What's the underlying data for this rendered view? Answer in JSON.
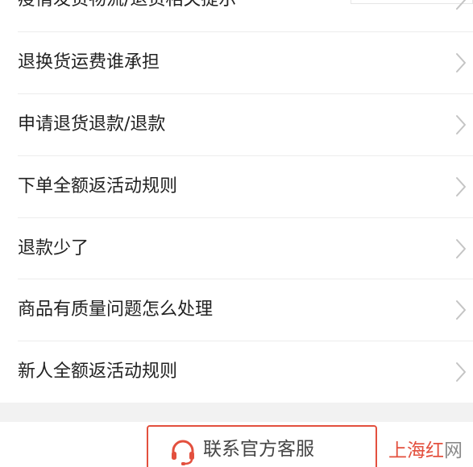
{
  "faq": {
    "items": [
      {
        "label": "疫情发货物流/退货相关提示"
      },
      {
        "label": "退换货运费谁承担"
      },
      {
        "label": "申请退货退款/退款"
      },
      {
        "label": "下单全额返活动规则"
      },
      {
        "label": "退款少了"
      },
      {
        "label": "商品有质量问题怎么处理"
      },
      {
        "label": "新人全额返活动规则"
      }
    ],
    "chevron_icon": "chevron-right-icon"
  },
  "bottom_bar": {
    "contact_label": "联系官方客服",
    "contact_icon": "headset-icon",
    "watermark_text": "上海红网",
    "watermark_accent": "#e3503e",
    "watermark_gray": "#8a8a8a"
  },
  "colors": {
    "accent": "#e3503e",
    "text": "#222222",
    "chevron": "#c4c4c4",
    "divider": "#ececec",
    "band": "#f2f2f2"
  }
}
